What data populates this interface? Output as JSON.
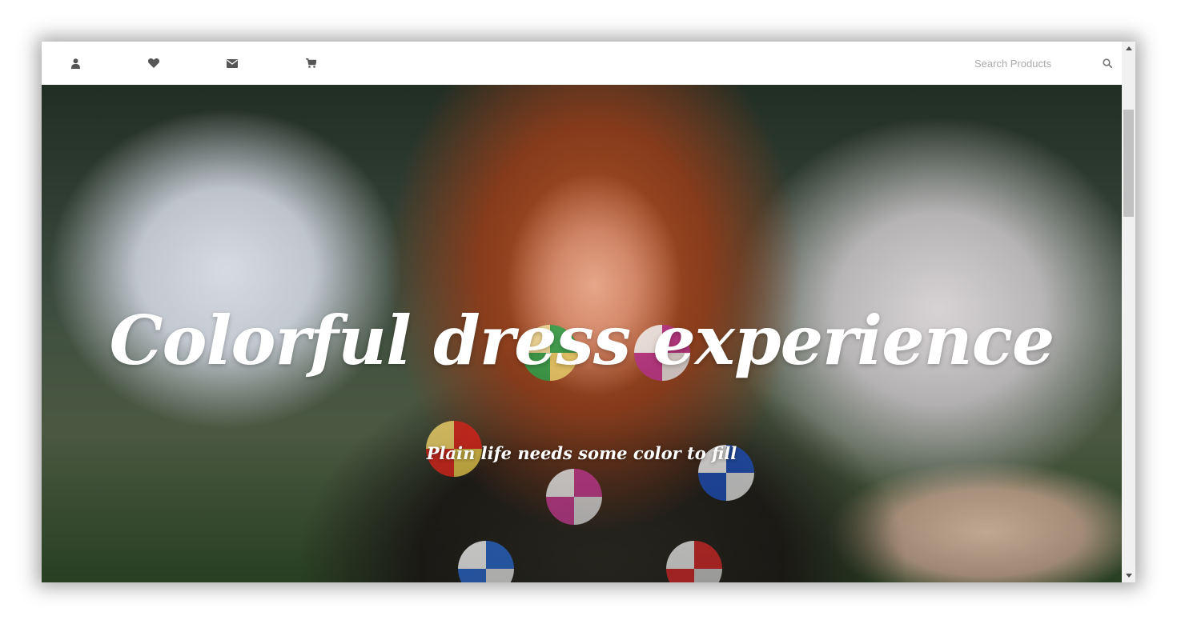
{
  "navbar": {
    "icons": [
      "user-icon",
      "heart-icon",
      "envelope-icon",
      "cart-icon"
    ],
    "search": {
      "placeholder": "Search Products",
      "value": "",
      "icon": "search-icon"
    }
  },
  "hero": {
    "title": "Colorful dress experience",
    "subtitle": "Plain life needs some color to fill"
  },
  "scrollbar": {
    "up_icon": "triangle-up-icon",
    "down_icon": "triangle-down-icon"
  },
  "colors": {
    "nav_icon": "#555555",
    "placeholder": "#aaaaaa",
    "hero_text": "#ffffff",
    "scroll_track": "#f1f1f1",
    "scroll_thumb": "#c1c1c1"
  }
}
